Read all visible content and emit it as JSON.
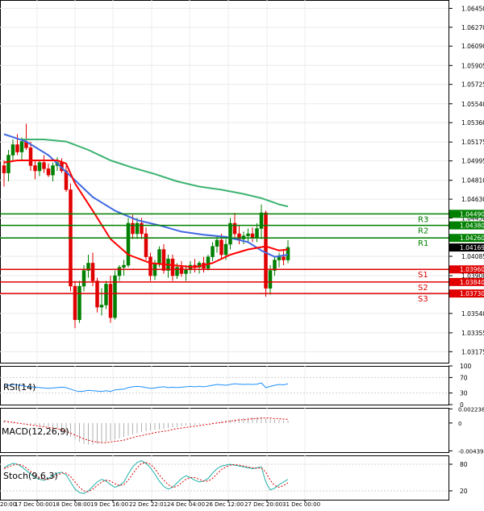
{
  "chart_data": {
    "type": "candlestick",
    "title": "",
    "main": {
      "ylim": [
        1.0307,
        1.0653
      ],
      "yticks": [
        "1.06450",
        "1.06270",
        "1.06090",
        "1.05905",
        "1.05725",
        "1.05540",
        "1.05360",
        "1.05175",
        "1.04995",
        "1.04810",
        "1.04630",
        "1.04450",
        "1.04265",
        "1.04085",
        "1.03900",
        "1.03720",
        "1.03540",
        "1.03355",
        "1.03175"
      ],
      "xticks": [
        "17 Dec 00:00",
        "18 Dec 08:00",
        "19 Dec 16:00",
        "22 Dec 22:01",
        "24 Dec 04:00",
        "26 Dec 12:00",
        "27 Dec 20:00",
        "31 Dec 00:00"
      ],
      "xtick_left_partial": "20:00",
      "last_price": "1.04169",
      "levels": [
        {
          "name": "R3",
          "value": 1.0449,
          "label": "1.04490",
          "color": "#008000"
        },
        {
          "name": "R2",
          "value": 1.0438,
          "label": "1.04380",
          "color": "#008000"
        },
        {
          "name": "R1",
          "value": 1.0426,
          "label": "1.04260",
          "color": "#008000"
        },
        {
          "name": "S1",
          "value": 1.0396,
          "label": "1.03960",
          "color": "#e00000"
        },
        {
          "name": "S2",
          "value": 1.0384,
          "label": "1.03840",
          "color": "#e00000"
        },
        {
          "name": "S3",
          "value": 1.0373,
          "label": "1.03730",
          "color": "#e00000"
        }
      ],
      "candles": [
        [
          1.0495,
          1.05,
          1.0475,
          1.0488
        ],
        [
          1.0488,
          1.051,
          1.048,
          1.0505
        ],
        [
          1.0505,
          1.052,
          1.05,
          1.0515
        ],
        [
          1.0515,
          1.0525,
          1.0505,
          1.0508
        ],
        [
          1.0508,
          1.0522,
          1.05,
          1.0518
        ],
        [
          1.0518,
          1.0535,
          1.051,
          1.0512
        ],
        [
          1.0512,
          1.0518,
          1.049,
          1.0495
        ],
        [
          1.0495,
          1.05,
          1.0482,
          1.049
        ],
        [
          1.049,
          1.05,
          1.0485,
          1.0498
        ],
        [
          1.0498,
          1.0505,
          1.0488,
          1.0492
        ],
        [
          1.0492,
          1.0497,
          1.0484,
          1.0486
        ],
        [
          1.0486,
          1.0498,
          1.048,
          1.0495
        ],
        [
          1.0495,
          1.0503,
          1.049,
          1.0498
        ],
        [
          1.0498,
          1.0502,
          1.0488,
          1.049
        ],
        [
          1.049,
          1.0495,
          1.047,
          1.0472
        ],
        [
          1.0472,
          1.0478,
          1.0375,
          1.038
        ],
        [
          1.038,
          1.0385,
          1.034,
          1.0348
        ],
        [
          1.0348,
          1.0385,
          1.0345,
          1.038
        ],
        [
          1.038,
          1.04,
          1.0375,
          1.0395
        ],
        [
          1.0395,
          1.041,
          1.0388,
          1.0402
        ],
        [
          1.0402,
          1.0412,
          1.038,
          1.0385
        ],
        [
          1.0385,
          1.0388,
          1.0355,
          1.036
        ],
        [
          1.036,
          1.0378,
          1.0352,
          1.0362
        ],
        [
          1.0362,
          1.0385,
          1.0358,
          1.0382
        ],
        [
          1.0382,
          1.039,
          1.0345,
          1.035
        ],
        [
          1.035,
          1.0395,
          1.0348,
          1.039
        ],
        [
          1.039,
          1.04,
          1.0385,
          1.0398
        ],
        [
          1.0398,
          1.0405,
          1.039,
          1.04
        ],
        [
          1.04,
          1.0445,
          1.0398,
          1.044
        ],
        [
          1.044,
          1.0448,
          1.0425,
          1.043
        ],
        [
          1.043,
          1.0445,
          1.0425,
          1.044
        ],
        [
          1.044,
          1.0445,
          1.0425,
          1.043
        ],
        [
          1.043,
          1.0436,
          1.0405,
          1.0408
        ],
        [
          1.0408,
          1.0412,
          1.0385,
          1.039
        ],
        [
          1.039,
          1.0405,
          1.0386,
          1.0402
        ],
        [
          1.0402,
          1.0418,
          1.0398,
          1.0415
        ],
        [
          1.0415,
          1.042,
          1.0392,
          1.0395
        ],
        [
          1.0395,
          1.041,
          1.0388,
          1.0406
        ],
        [
          1.0406,
          1.041,
          1.0385,
          1.039
        ],
        [
          1.039,
          1.0402,
          1.0387,
          1.0398
        ],
        [
          1.0398,
          1.0404,
          1.0389,
          1.0392
        ],
        [
          1.0392,
          1.04,
          1.0385,
          1.0396
        ],
        [
          1.0396,
          1.0404,
          1.0392,
          1.04
        ],
        [
          1.04,
          1.0406,
          1.0393,
          1.0398
        ],
        [
          1.0398,
          1.0404,
          1.0392,
          1.0402
        ],
        [
          1.0402,
          1.0408,
          1.0393,
          1.0397
        ],
        [
          1.0397,
          1.041,
          1.0395,
          1.0408
        ],
        [
          1.0408,
          1.0422,
          1.0404,
          1.0418
        ],
        [
          1.0418,
          1.0428,
          1.0412,
          1.0424
        ],
        [
          1.0424,
          1.043,
          1.0406,
          1.041
        ],
        [
          1.041,
          1.0425,
          1.0405,
          1.042
        ],
        [
          1.042,
          1.0445,
          1.0415,
          1.044
        ],
        [
          1.044,
          1.045,
          1.0425,
          1.043
        ],
        [
          1.043,
          1.0438,
          1.042,
          1.0425
        ],
        [
          1.0425,
          1.0432,
          1.042,
          1.0428
        ],
        [
          1.0428,
          1.0435,
          1.0422,
          1.043
        ],
        [
          1.043,
          1.0436,
          1.0422,
          1.0426
        ],
        [
          1.0426,
          1.044,
          1.0422,
          1.0435
        ],
        [
          1.0435,
          1.0458,
          1.0425,
          1.045
        ],
        [
          1.045,
          1.0452,
          1.037,
          1.0378
        ],
        [
          1.0378,
          1.04,
          1.0372,
          1.0395
        ],
        [
          1.0395,
          1.0408,
          1.039,
          1.0405
        ],
        [
          1.0405,
          1.0412,
          1.0398,
          1.0408
        ],
        [
          1.0408,
          1.0414,
          1.04,
          1.0405
        ],
        [
          1.0405,
          1.0424,
          1.0402,
          1.0417
        ]
      ],
      "ma_red": [
        [
          0,
          1.0498
        ],
        [
          3,
          1.05
        ],
        [
          8,
          1.05
        ],
        [
          12,
          1.05
        ],
        [
          14,
          1.0497
        ],
        [
          16,
          1.0478
        ],
        [
          20,
          1.0452
        ],
        [
          24,
          1.0425
        ],
        [
          28,
          1.041
        ],
        [
          33,
          1.0402
        ],
        [
          38,
          1.04
        ],
        [
          43,
          1.0398
        ],
        [
          47,
          1.0402
        ],
        [
          51,
          1.041
        ],
        [
          55,
          1.0415
        ],
        [
          59,
          1.0418
        ],
        [
          62,
          1.0414
        ],
        [
          64,
          1.0415
        ]
      ],
      "ma_blue": [
        [
          0,
          1.0525
        ],
        [
          5,
          1.0518
        ],
        [
          10,
          1.0505
        ],
        [
          15,
          1.0485
        ],
        [
          20,
          1.0465
        ],
        [
          25,
          1.0452
        ],
        [
          30,
          1.0443
        ],
        [
          35,
          1.0438
        ],
        [
          40,
          1.0432
        ],
        [
          45,
          1.0429
        ],
        [
          50,
          1.0427
        ],
        [
          55,
          1.0422
        ],
        [
          58,
          1.0414
        ],
        [
          61,
          1.0408
        ],
        [
          64,
          1.041
        ]
      ],
      "ma_green": [
        [
          4,
          1.052
        ],
        [
          9,
          1.052
        ],
        [
          14,
          1.0518
        ],
        [
          19,
          1.051
        ],
        [
          24,
          1.05
        ],
        [
          29,
          1.0493
        ],
        [
          34,
          1.0487
        ],
        [
          39,
          1.048
        ],
        [
          44,
          1.0475
        ],
        [
          49,
          1.0472
        ],
        [
          54,
          1.0468
        ],
        [
          58,
          1.0464
        ],
        [
          62,
          1.0458
        ],
        [
          64,
          1.0456
        ]
      ]
    },
    "rsi": {
      "label": "RSI(14)",
      "yticks": [
        "100",
        "70",
        "30",
        "0"
      ],
      "values": [
        48,
        50,
        52,
        51,
        49,
        47,
        46,
        45,
        44,
        43,
        42,
        43,
        44,
        45,
        44,
        40,
        36,
        34,
        35,
        37,
        36,
        35,
        34,
        36,
        34,
        38,
        39,
        40,
        44,
        46,
        47,
        46,
        44,
        42,
        43,
        45,
        46,
        44,
        45,
        44,
        45,
        46,
        47,
        46,
        47,
        46,
        48,
        50,
        52,
        51,
        50,
        52,
        54,
        53,
        52,
        53,
        52,
        53,
        56,
        44,
        47,
        50,
        52,
        51,
        54
      ]
    },
    "macd": {
      "label": "MACD(12,26,9)",
      "yticks": [
        "0.002238",
        "0",
        "-0.004397"
      ],
      "ylim": [
        -0.0046,
        0.0024
      ],
      "hist": [
        0.0004,
        0.0003,
        0.0002,
        0.0001,
        0,
        -0.0001,
        -0.0002,
        -0.0003,
        -0.0004,
        -0.0005,
        -0.0006,
        -0.0008,
        -0.001,
        -0.0013,
        -0.0017,
        -0.0022,
        -0.0026,
        -0.003,
        -0.0033,
        -0.0034,
        -0.0034,
        -0.0033,
        -0.0032,
        -0.003,
        -0.0028,
        -0.0026,
        -0.0024,
        -0.0022,
        -0.002,
        -0.0018,
        -0.0016,
        -0.0014,
        -0.0013,
        -0.0012,
        -0.0011,
        -0.001,
        -0.0009,
        -0.0008,
        -0.0007,
        -0.0006,
        -0.0005,
        -0.0004,
        -0.0004,
        -0.0003,
        -0.0002,
        -0.0001,
        0,
        0.0001,
        0.0002,
        0.0003,
        0.0004,
        0.0005,
        0.0006,
        0.0007,
        0.0008,
        0.0008,
        0.0009,
        0.0009,
        0.0009,
        0.0007,
        0.0006,
        0.0005,
        0.0005,
        0.0004,
        0.0004
      ],
      "signal": [
        0.0003,
        0.0002,
        0.0001,
        0,
        -0.0001,
        -0.0002,
        -0.0003,
        -0.0004,
        -0.0005,
        -0.0006,
        -0.0007,
        -0.0008,
        -0.0009,
        -0.0011,
        -0.0013,
        -0.0016,
        -0.0019,
        -0.0022,
        -0.0025,
        -0.0027,
        -0.0029,
        -0.003,
        -0.0031,
        -0.0031,
        -0.003,
        -0.0029,
        -0.0028,
        -0.0027,
        -0.0025,
        -0.0023,
        -0.0021,
        -0.002,
        -0.0018,
        -0.0017,
        -0.0015,
        -0.0014,
        -0.0013,
        -0.0012,
        -0.001,
        -0.0009,
        -0.0008,
        -0.0007,
        -0.0006,
        -0.0005,
        -0.0004,
        -0.0003,
        -0.0002,
        -0.0001,
        0,
        0.0001,
        0.0002,
        0.0003,
        0.0004,
        0.0005,
        0.0005,
        0.0006,
        0.0007,
        0.0007,
        0.0008,
        0.0008,
        0.0008,
        0.0007,
        0.0007,
        0.0006,
        0.0006
      ]
    },
    "stoch": {
      "label": "Stoch(9,6,3)",
      "yticks": [
        "80",
        "20"
      ],
      "k": [
        72,
        78,
        82,
        80,
        74,
        66,
        58,
        50,
        46,
        44,
        48,
        54,
        60,
        62,
        56,
        40,
        24,
        16,
        14,
        20,
        30,
        40,
        46,
        42,
        34,
        28,
        32,
        40,
        58,
        74,
        84,
        88,
        82,
        72,
        58,
        42,
        30,
        24,
        28,
        38,
        48,
        54,
        50,
        44,
        40,
        42,
        48,
        60,
        70,
        76,
        78,
        80,
        78,
        76,
        74,
        72,
        70,
        72,
        74,
        40,
        22,
        26,
        34,
        40,
        46
      ],
      "d": [
        70,
        74,
        78,
        80,
        78,
        72,
        64,
        56,
        50,
        46,
        46,
        50,
        56,
        60,
        60,
        52,
        40,
        28,
        20,
        18,
        24,
        32,
        40,
        44,
        42,
        36,
        32,
        34,
        44,
        58,
        72,
        82,
        84,
        80,
        70,
        56,
        44,
        34,
        28,
        30,
        38,
        46,
        50,
        50,
        46,
        42,
        42,
        48,
        58,
        68,
        74,
        78,
        79,
        78,
        76,
        74,
        72,
        71,
        72,
        62,
        44,
        32,
        28,
        32,
        38
      ]
    }
  }
}
